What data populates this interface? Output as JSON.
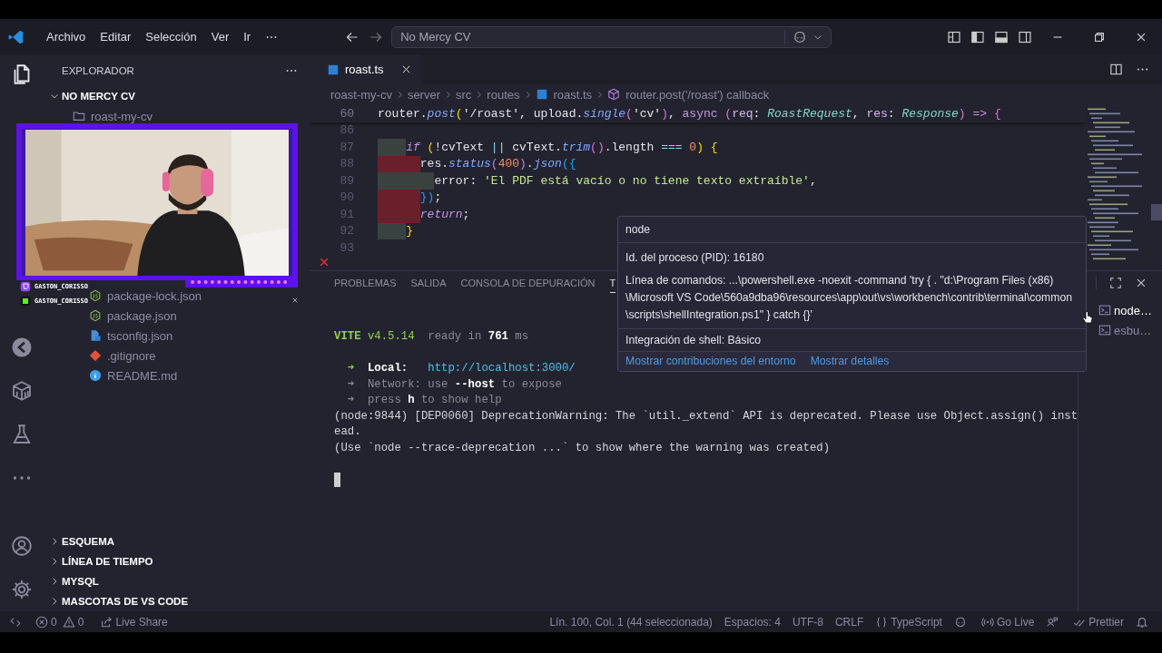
{
  "title_bar": {
    "menu": [
      {
        "label": "Archivo"
      },
      {
        "label": "Editar"
      },
      {
        "label": "Selección"
      },
      {
        "label": "Ver"
      },
      {
        "label": "Ir"
      }
    ],
    "command_center": {
      "label": "No Mercy CV"
    }
  },
  "sidebar": {
    "title": "EXPLORADOR",
    "workspace": {
      "label": "NO MERCY CV",
      "expanded": true,
      "children": [
        {
          "label": "roast-my-cv",
          "kind": "folder",
          "children": [
            {
              "label": "package-lock.json",
              "kind": "json"
            },
            {
              "label": "package.json",
              "kind": "json"
            },
            {
              "label": "tsconfig.json",
              "kind": "tsconfig"
            },
            {
              "label": ".gitignore",
              "kind": "git"
            },
            {
              "label": "README.md",
              "kind": "info"
            }
          ]
        }
      ]
    },
    "sections": [
      {
        "label": "ESQUEMA",
        "expanded": false
      },
      {
        "label": "LÍNEA DE TIEMPO",
        "expanded": false
      },
      {
        "label": "MYSQL",
        "expanded": false
      },
      {
        "label": "MASCOTAS DE VS CODE",
        "expanded": false
      }
    ]
  },
  "stream_overlay": {
    "handles": [
      {
        "kind": "twitch",
        "label": "GASTON_CORISSO"
      },
      {
        "kind": "kick",
        "label": "GASTON_CORISSO"
      }
    ]
  },
  "editor": {
    "tabs": [
      {
        "label": "roast.ts",
        "selected": true
      }
    ],
    "breadcrumbs": [
      {
        "label": "roast-my-cv"
      },
      {
        "label": "server"
      },
      {
        "label": "src"
      },
      {
        "label": "routes"
      },
      {
        "label": "roast.ts",
        "kind": "file"
      },
      {
        "label": "router.post('/roast') callback",
        "kind": "symbol"
      }
    ],
    "lines": [
      {
        "number": "60",
        "sticky": true,
        "tokens": [
          {
            "text": "router.",
            "kind": "plain"
          },
          {
            "text": "post",
            "kind": "fn"
          },
          {
            "text": "(",
            "kind": "b1"
          },
          {
            "text": "'/roast'",
            "kind": "plain"
          },
          {
            "text": ", upload.",
            "kind": "plain"
          },
          {
            "text": "single",
            "kind": "fn"
          },
          {
            "text": "(",
            "kind": "b2"
          },
          {
            "text": "'cv'",
            "kind": "plain"
          },
          {
            "text": ")",
            "kind": "b2"
          },
          {
            "text": ", ",
            "kind": "plain"
          },
          {
            "text": "async",
            "kind": "kw2"
          },
          {
            "text": " (",
            "kind": "b2"
          },
          {
            "text": "req",
            "kind": "param"
          },
          {
            "text": ": ",
            "kind": "plain"
          },
          {
            "text": "RoastRequest",
            "kind": "type"
          },
          {
            "text": ", ",
            "kind": "plain"
          },
          {
            "text": "res",
            "kind": "param"
          },
          {
            "text": ": ",
            "kind": "plain"
          },
          {
            "text": "Response",
            "kind": "type"
          },
          {
            "text": ")",
            "kind": "b2"
          },
          {
            "text": " => ",
            "kind": "kw2"
          },
          {
            "text": "{",
            "kind": "b2"
          }
        ]
      },
      {
        "number": "86"
      },
      {
        "number": "87",
        "indent_error": false,
        "tokens": [
          {
            "text": "    if",
            "kind": "kw"
          },
          {
            "text": " (",
            "kind": "b1"
          },
          {
            "text": "!cvText ",
            "kind": "plain"
          },
          {
            "text": "||",
            "kind": "op"
          },
          {
            "text": " cvText.",
            "kind": "plain"
          },
          {
            "text": "trim",
            "kind": "fn"
          },
          {
            "text": "()",
            "kind": "b2"
          },
          {
            "text": ".length ",
            "kind": "plain"
          },
          {
            "text": "=== ",
            "kind": "op"
          },
          {
            "text": "0",
            "kind": "num"
          },
          {
            "text": ")",
            "kind": "b1"
          },
          {
            "text": " {",
            "kind": "b1"
          }
        ]
      },
      {
        "number": "88",
        "indent_error": true,
        "tokens": [
          {
            "text": "      res.",
            "kind": "plain"
          },
          {
            "text": "status",
            "kind": "fn"
          },
          {
            "text": "(",
            "kind": "b2"
          },
          {
            "text": "400",
            "kind": "num"
          },
          {
            "text": ")",
            "kind": "b2"
          },
          {
            "text": ".",
            "kind": "plain"
          },
          {
            "text": "json",
            "kind": "fn"
          },
          {
            "text": "({",
            "kind": "b3"
          }
        ]
      },
      {
        "number": "89",
        "indent_error": false,
        "tokens": [
          {
            "text": "        error: ",
            "kind": "plain"
          },
          {
            "text": "'El PDF está vacío o no tiene texto extraíble'",
            "kind": "str"
          },
          {
            "text": ",",
            "kind": "plain"
          }
        ]
      },
      {
        "number": "90",
        "indent_error": true,
        "tokens": [
          {
            "text": "      })",
            "kind": "b3"
          },
          {
            "text": ";",
            "kind": "plain"
          }
        ]
      },
      {
        "number": "91",
        "indent_error": true,
        "tokens": [
          {
            "text": "      return",
            "kind": "kw"
          },
          {
            "text": ";",
            "kind": "plain"
          }
        ]
      },
      {
        "number": "92",
        "indent_error": false,
        "tokens": [
          {
            "text": "    }",
            "kind": "b1"
          }
        ]
      },
      {
        "number": "93"
      }
    ]
  },
  "panel": {
    "tabs": [
      {
        "label": "PROBLEMAS",
        "selected": false
      },
      {
        "label": "SALIDA",
        "selected": false
      },
      {
        "label": "CONSOLA DE DEPURACIÓN",
        "selected": false
      },
      {
        "label": "T",
        "selected": true
      }
    ],
    "terminal": {
      "cursor_visible": true,
      "blocks": [
        [
          [
            {
              "text": "VITE",
              "kind": "green-bold"
            },
            {
              "text": " v4.5.14",
              "kind": "green"
            },
            {
              "text": "  ready in ",
              "kind": "dim"
            },
            {
              "text": "761",
              "kind": "bold"
            },
            {
              "text": " ms",
              "kind": "dim"
            }
          ]
        ],
        [
          [
            {
              "text": "  ➜",
              "kind": "green"
            },
            {
              "text": "  Local:",
              "kind": "bold"
            },
            {
              "text": "   http://localhost:3000/",
              "kind": "link"
            }
          ],
          [
            {
              "text": "  ➜  Network: use ",
              "kind": "dim"
            },
            {
              "text": "--host",
              "kind": "bold"
            },
            {
              "text": " to expose",
              "kind": "dim"
            }
          ],
          [
            {
              "text": "  ➜  press ",
              "kind": "dim"
            },
            {
              "text": "h",
              "kind": "bold"
            },
            {
              "text": " to show help",
              "kind": "dim"
            }
          ],
          [
            {
              "text": "(node:9844) [DEP0060] DeprecationWarning: The `util._extend` API is deprecated. Please use Object.assign() inst",
              "kind": "plain"
            }
          ],
          [
            {
              "text": "ead.",
              "kind": "plain"
            }
          ],
          [
            {
              "text": "(Use `node --trace-deprecation ...` to show where the warning was created)",
              "kind": "plain"
            }
          ]
        ]
      ]
    },
    "terminals": [
      {
        "label": "node…",
        "selected": true
      },
      {
        "label": "esbu…",
        "selected": false
      }
    ]
  },
  "hover": {
    "title": "node",
    "rows": [
      {
        "text": "Id. del proceso (PID): 16180"
      },
      {
        "text": "Línea de comandos: ...\\powershell.exe -noexit -command 'try { . \"d:\\Program Files (x86)\\Microsoft VS Code\\560a9dba96\\resources\\app\\out\\vs\\workbench\\contrib\\terminal\\common\\scripts\\shellIntegration.ps1\" } catch {}'"
      }
    ],
    "note": "Integración de shell: Básico",
    "links": [
      {
        "label": "Mostrar contribuciones del entorno"
      },
      {
        "label": "Mostrar detalles"
      }
    ]
  },
  "status_bar": {
    "errors": "0",
    "warnings": "0",
    "left": [
      {
        "kind": "share",
        "label": "Live Share"
      }
    ],
    "right": [
      {
        "kind": "text",
        "label": "Lín. 100, Col. 1 (44 seleccionada)"
      },
      {
        "kind": "text",
        "label": "Espacios: 4"
      },
      {
        "kind": "text",
        "label": "UTF-8"
      },
      {
        "kind": "text",
        "label": "CRLF"
      },
      {
        "kind": "braces",
        "label": "TypeScript"
      },
      {
        "kind": "copilot"
      },
      {
        "kind": "broadcast",
        "label": "Go Live"
      },
      {
        "kind": "feedback"
      },
      {
        "kind": "checks",
        "label": "Prettier"
      },
      {
        "kind": "bell"
      }
    ]
  }
}
